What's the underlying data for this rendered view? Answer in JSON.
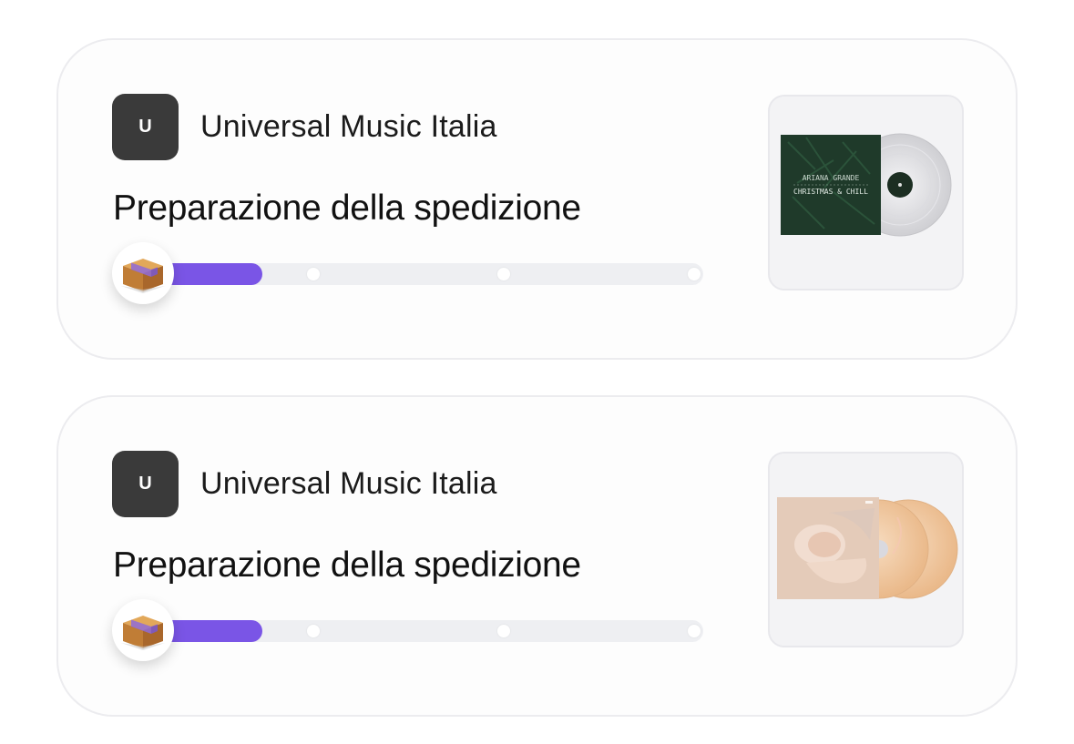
{
  "orders": [
    {
      "seller_initial": "U",
      "seller_name": "Universal Music Italia",
      "status": "Preparazione della spedizione",
      "progress": 0.19,
      "package_icon": "package-box-icon",
      "product": {
        "cover_title_line1": "ARIANA GRANDE",
        "cover_title_line2": "CHRISTMAS & CHILL",
        "label_text": "ARIANA GRANDE",
        "cover_color": "#1f3a2a",
        "vinyl_color": "#d8d8da"
      }
    },
    {
      "seller_initial": "U",
      "seller_name": "Universal Music Italia",
      "status": "Preparazione della spedizione",
      "progress": 0.19,
      "package_icon": "package-box-icon",
      "product": {
        "cover_color": "#e9d2c0",
        "vinyl_color": "#f2caa0"
      }
    }
  ],
  "colors": {
    "progress_fill": "#7a55e6",
    "track": "#eeeff2"
  }
}
